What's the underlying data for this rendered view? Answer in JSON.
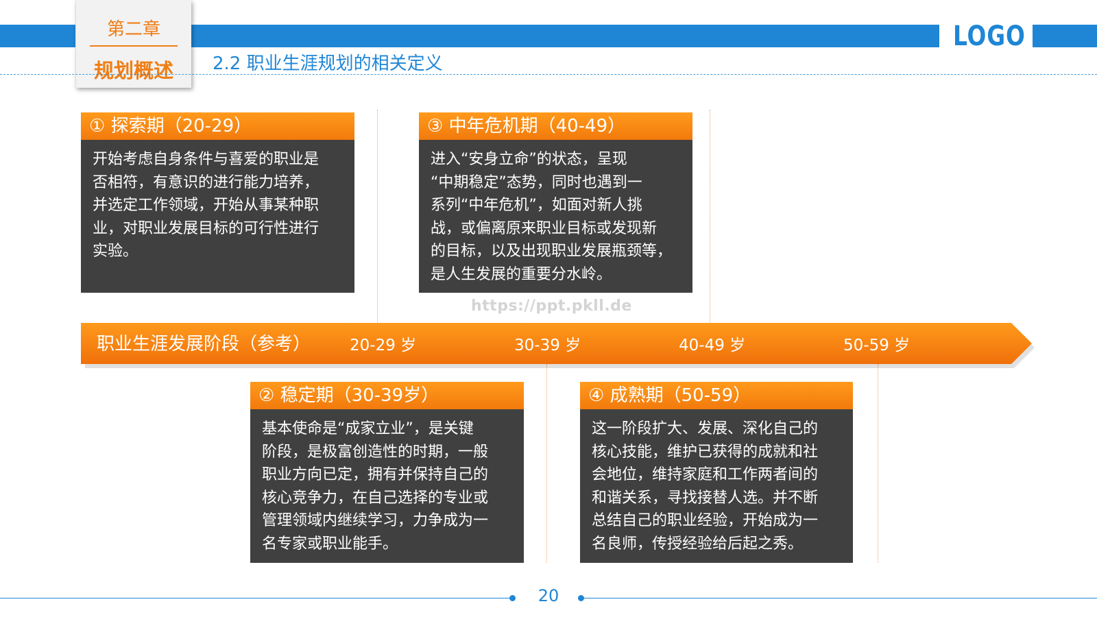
{
  "header": {
    "chapter_num": "第二章",
    "chapter_title": "规划概述",
    "section_title": "2.2 职业生涯规划的相关定义",
    "logo": "LOGO"
  },
  "timeline": {
    "title": "职业生涯发展阶段（参考）",
    "labels": [
      "20-29 岁",
      "30-39 岁",
      "40-49 岁",
      "50-59 岁"
    ]
  },
  "cards": [
    {
      "title": "① 探索期（20-29）",
      "body": "开始考虑自身条件与喜爱的职业是\n否相符，有意识的进行能力培养，\n并选定工作领域，开始从事某种职\n业，对职业发展目标的可行性进行\n实验。"
    },
    {
      "title": "② 稳定期（30-39岁）",
      "body": "基本使命是“成家立业”，是关键\n阶段，是极富创造性的时期，一般\n职业方向已定，拥有并保持自己的\n核心竞争力，在自己选择的专业或\n管理领域内继续学习，力争成为一\n名专家或职业能手。"
    },
    {
      "title": "③ 中年危机期（40-49）",
      "body": "进入“安身立命”的状态，呈现\n“中期稳定”态势，同时也遇到一\n系列“中年危机”，如面对新人挑\n战，或偏离原来职业目标或发现新\n的目标，以及出现职业发展瓶颈等，\n是人生发展的重要分水岭。"
    },
    {
      "title": "④ 成熟期（50-59）",
      "body": "这一阶段扩大、发展、深化自己的\n核心技能，维护已获得的成就和社\n会地位，维持家庭和工作两者间的\n和谐关系，寻找接替人选。并不断\n总结自己的职业经验，开始成为一\n名良师，传授经验给后起之秀。"
    }
  ],
  "watermark": "https://ppt.pkll.de",
  "footer": {
    "page": "20"
  },
  "colors": {
    "blue": "#1f86d6",
    "orange": "#f27a0c",
    "card_bg": "#404040"
  }
}
